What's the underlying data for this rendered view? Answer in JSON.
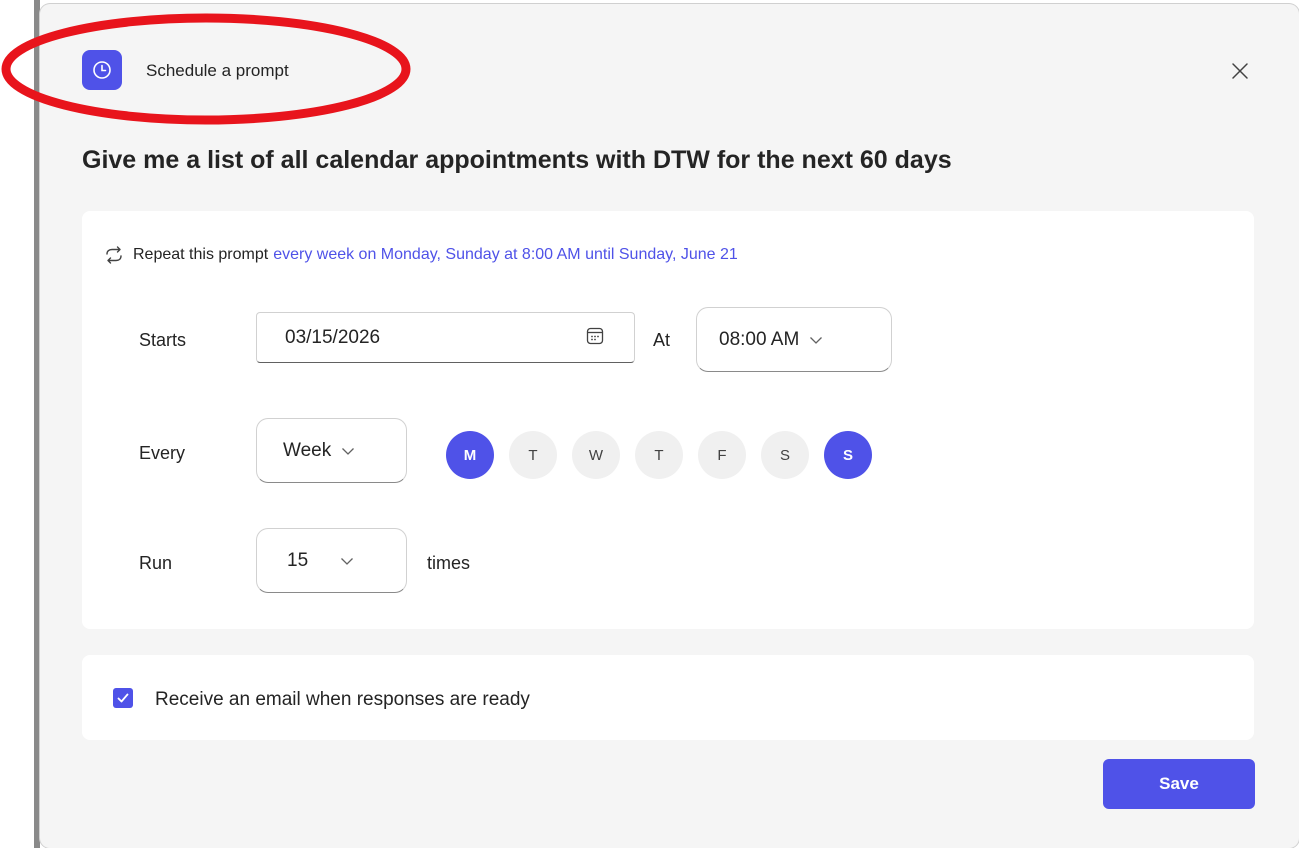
{
  "dialog": {
    "header_title": "Schedule a prompt",
    "header_icon": "clock-icon",
    "close_icon": "close-icon",
    "prompt_text": "Give me a list of all calendar appointments with DTW for the next 60 days"
  },
  "schedule": {
    "repeat_prefix": "Repeat this prompt",
    "repeat_summary": "every week on Monday, Sunday at 8:00 AM until Sunday, June 21",
    "starts_label": "Starts",
    "start_date": "03/15/2026",
    "at_label": "At",
    "time_value": "08:00 AM",
    "every_label": "Every",
    "frequency_value": "Week",
    "days": [
      {
        "label": "M",
        "selected": true
      },
      {
        "label": "T",
        "selected": false
      },
      {
        "label": "W",
        "selected": false
      },
      {
        "label": "T",
        "selected": false
      },
      {
        "label": "F",
        "selected": false
      },
      {
        "label": "S",
        "selected": false
      },
      {
        "label": "S",
        "selected": true
      }
    ],
    "run_label": "Run",
    "run_count": "15",
    "times_label": "times"
  },
  "email": {
    "checked": true,
    "label": "Receive an email when responses are ready"
  },
  "footer": {
    "save_label": "Save"
  },
  "colors": {
    "accent": "#4f52e8",
    "annotation": "#e8141c"
  }
}
